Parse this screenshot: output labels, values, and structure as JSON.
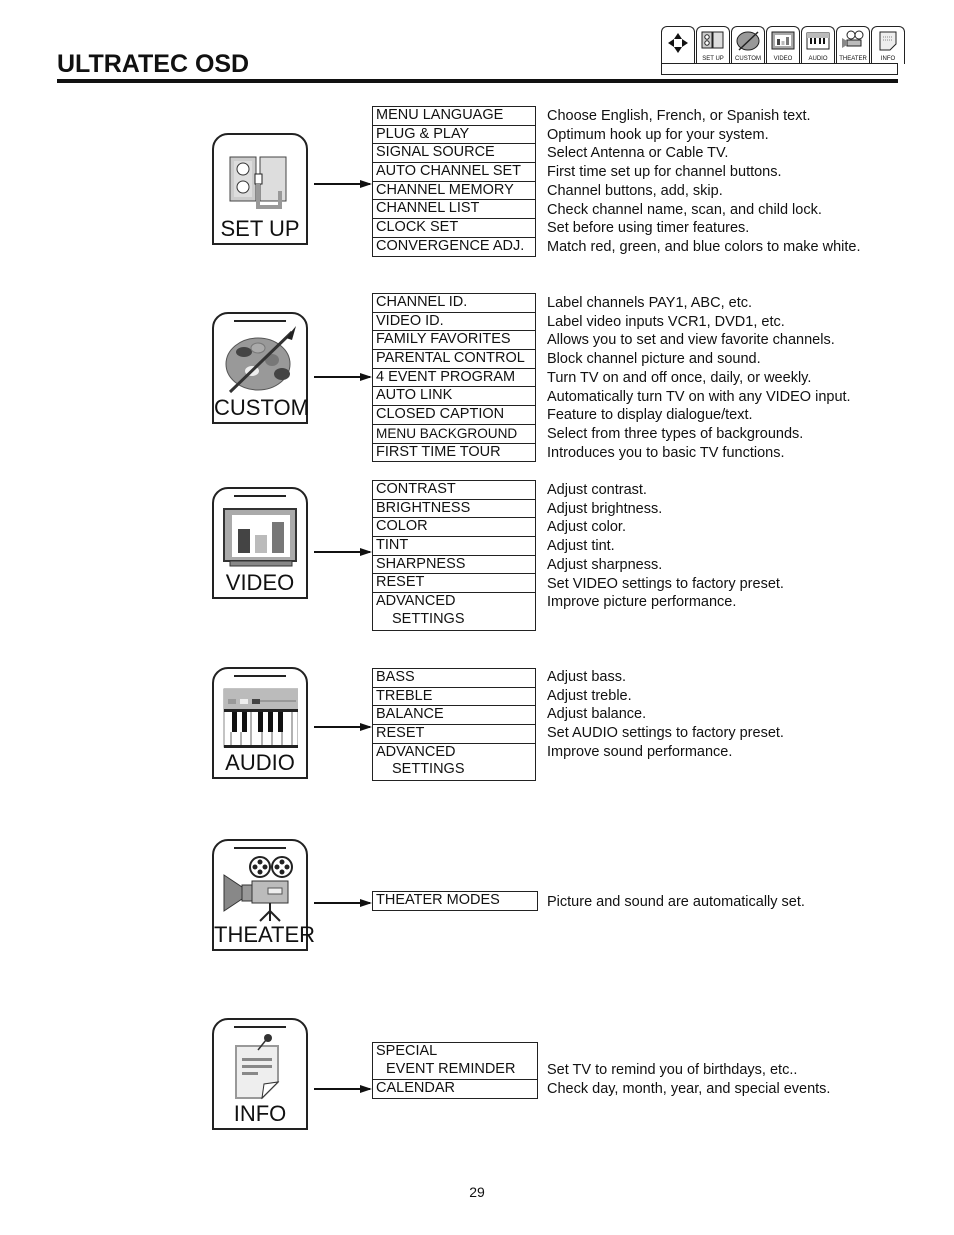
{
  "header": {
    "title": "ULTRATEC OSD"
  },
  "nav_strip": {
    "tabs": [
      {
        "icon": "move-arrows-icon",
        "label": ""
      },
      {
        "icon": "outlet-icon",
        "label": "SET UP"
      },
      {
        "icon": "palette-icon",
        "label": "CUSTOM"
      },
      {
        "icon": "tv-bars-icon",
        "label": "VIDEO"
      },
      {
        "icon": "keyboard-icon",
        "label": "AUDIO"
      },
      {
        "icon": "projector-icon",
        "label": "THEATER"
      },
      {
        "icon": "note-icon",
        "label": "INFO"
      }
    ]
  },
  "sections": [
    {
      "name": "SET UP",
      "icon": "outlet-icon",
      "items": [
        {
          "label": "MENU LANGUAGE",
          "desc": "Choose English, French, or Spanish text."
        },
        {
          "label": "PLUG & PLAY",
          "desc": "Optimum hook up for your system."
        },
        {
          "label": "SIGNAL SOURCE",
          "desc": "Select Antenna or Cable TV."
        },
        {
          "label": "AUTO CHANNEL SET",
          "desc": "First time set up for channel buttons."
        },
        {
          "label": "CHANNEL MEMORY",
          "desc": "Channel buttons, add, skip."
        },
        {
          "label": "CHANNEL LIST",
          "desc": "Check channel name, scan, and child lock."
        },
        {
          "label": "CLOCK SET",
          "desc": "Set before using timer features."
        },
        {
          "label": "CONVERGENCE ADJ.",
          "desc": "Match red, green, and blue colors to make white."
        }
      ]
    },
    {
      "name": "CUSTOM",
      "icon": "palette-icon",
      "items": [
        {
          "label": "CHANNEL ID.",
          "desc": "Label channels PAY1, ABC, etc."
        },
        {
          "label": "VIDEO ID.",
          "desc": "Label video inputs VCR1, DVD1, etc."
        },
        {
          "label": "FAMILY FAVORITES",
          "desc": "Allows you to set and view favorite channels."
        },
        {
          "label": "PARENTAL CONTROL",
          "desc": "Block channel picture and sound."
        },
        {
          "label": "4 EVENT PROGRAM",
          "desc": "Turn TV on and off once, daily, or weekly."
        },
        {
          "label": "AUTO LINK",
          "desc": "Automatically turn TV on with any VIDEO input."
        },
        {
          "label": "CLOSED CAPTION",
          "desc": "Feature to display dialogue/text."
        },
        {
          "label": "MENU BACKGROUND",
          "desc": "Select from three types of backgrounds."
        },
        {
          "label": "FIRST TIME TOUR",
          "desc": "Introduces you to basic TV functions."
        }
      ]
    },
    {
      "name": "VIDEO",
      "icon": "tv-bars-icon",
      "items": [
        {
          "label": "CONTRAST",
          "desc": "Adjust contrast."
        },
        {
          "label": "BRIGHTNESS",
          "desc": "Adjust brightness."
        },
        {
          "label": "COLOR",
          "desc": "Adjust color."
        },
        {
          "label": "TINT",
          "desc": "Adjust tint."
        },
        {
          "label": "SHARPNESS",
          "desc": "Adjust sharpness."
        },
        {
          "label": "RESET",
          "desc": "Set VIDEO settings to factory preset."
        },
        {
          "label": "ADVANCED",
          "label2": "SETTINGS",
          "desc": "Improve picture performance."
        }
      ]
    },
    {
      "name": "AUDIO",
      "icon": "keyboard-icon",
      "items": [
        {
          "label": "BASS",
          "desc": "Adjust bass."
        },
        {
          "label": "TREBLE",
          "desc": "Adjust treble."
        },
        {
          "label": "BALANCE",
          "desc": "Adjust balance."
        },
        {
          "label": "RESET",
          "desc": "Set AUDIO settings to factory preset."
        },
        {
          "label": "ADVANCED",
          "label2": "SETTINGS",
          "desc": "Improve sound performance."
        }
      ]
    },
    {
      "name": "THEATER",
      "icon": "projector-icon",
      "items": [
        {
          "label": "THEATER MODES",
          "desc": "Picture and sound are automatically set."
        }
      ]
    },
    {
      "name": "INFO",
      "icon": "note-icon",
      "items": [
        {
          "label": "SPECIAL",
          "label2": "EVENT REMINDER",
          "desc": "Set TV to remind you of birthdays, etc.."
        },
        {
          "label": "CALENDAR",
          "desc": "Check day, month, year, and special events."
        }
      ]
    }
  ],
  "footer": {
    "page_number": "29"
  }
}
